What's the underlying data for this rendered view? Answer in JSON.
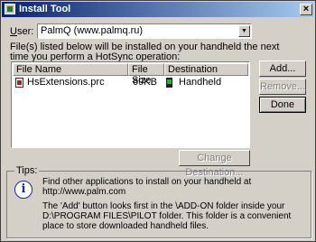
{
  "window": {
    "title": "Install Tool"
  },
  "user": {
    "label_prefix": "U",
    "label_rest": "ser:",
    "selected": "PalmQ (www.palmq.ru)",
    "arrow": "▼"
  },
  "instructions": {
    "line1": "File(s) listed below will be installed on your handheld the next",
    "line2": "time you perform a HotSync operation:"
  },
  "list": {
    "columns": [
      "File Name",
      "File Size",
      "Destination"
    ],
    "rows": [
      {
        "name": "HsExtensions.prc",
        "size": "69KB",
        "destination": "Handheld"
      }
    ]
  },
  "buttons": {
    "add": "Add...",
    "remove": "Remove...",
    "done": "Done",
    "change_destination": "Change Destination..."
  },
  "tips": {
    "title": "Tips:",
    "line1": "Find other applications to install on your handheld at",
    "line2": "http://www.palm.com",
    "line3": "The 'Add' button looks first in the \\ADD-ON folder inside your",
    "line4": "D:\\PROGRAM FILES\\PILOT folder. This folder is a convenient",
    "line5": "place to store downloaded handheld files."
  }
}
